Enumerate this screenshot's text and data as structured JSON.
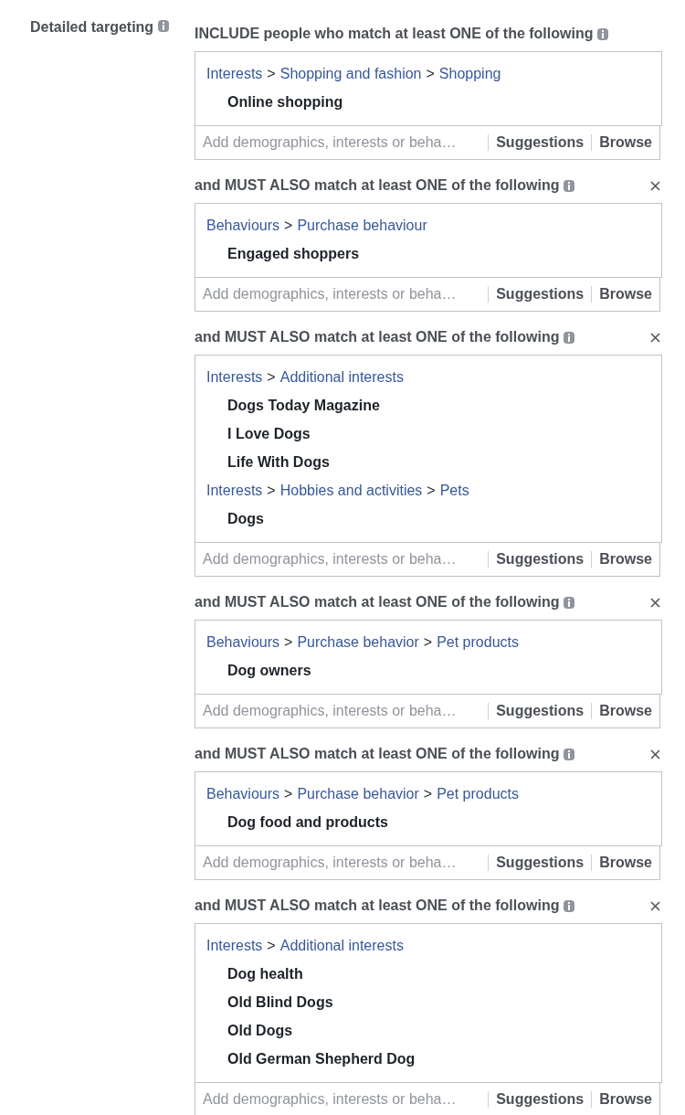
{
  "label": "Detailed targeting",
  "groups": [
    {
      "heading": "INCLUDE people who match at least ONE of the following",
      "removable": false,
      "paths": [
        {
          "crumbs": [
            "Interests",
            ">",
            "Shopping and fashion",
            ">",
            "Shopping"
          ],
          "items": [
            "Online shopping"
          ]
        }
      ],
      "placeholder": "Add demographics, interests or beha…",
      "suggestions": "Suggestions",
      "browse": "Browse"
    },
    {
      "heading": "and MUST ALSO match at least ONE of the following",
      "removable": true,
      "paths": [
        {
          "crumbs": [
            "Behaviours",
            ">",
            "Purchase behaviour"
          ],
          "items": [
            "Engaged shoppers"
          ]
        }
      ],
      "placeholder": "Add demographics, interests or beha…",
      "suggestions": "Suggestions",
      "browse": "Browse"
    },
    {
      "heading": "and MUST ALSO match at least ONE of the following",
      "removable": true,
      "paths": [
        {
          "crumbs": [
            "Interests",
            ">",
            "Additional interests"
          ],
          "items": [
            "Dogs Today Magazine",
            "I Love Dogs",
            "Life With Dogs"
          ]
        },
        {
          "crumbs": [
            "Interests",
            ">",
            "Hobbies and activities",
            ">",
            "Pets"
          ],
          "items": [
            "Dogs"
          ]
        }
      ],
      "placeholder": "Add demographics, interests or beha…",
      "suggestions": "Suggestions",
      "browse": "Browse"
    },
    {
      "heading": "and MUST ALSO match at least ONE of the following",
      "removable": true,
      "paths": [
        {
          "crumbs": [
            "Behaviours",
            ">",
            "Purchase behavior",
            ">",
            "Pet products"
          ],
          "items": [
            "Dog owners"
          ]
        }
      ],
      "placeholder": "Add demographics, interests or beha…",
      "suggestions": "Suggestions",
      "browse": "Browse"
    },
    {
      "heading": "and MUST ALSO match at least ONE of the following",
      "removable": true,
      "paths": [
        {
          "crumbs": [
            "Behaviours",
            ">",
            "Purchase behavior",
            ">",
            "Pet products"
          ],
          "items": [
            "Dog food and products"
          ]
        }
      ],
      "placeholder": "Add demographics, interests or beha…",
      "suggestions": "Suggestions",
      "browse": "Browse"
    },
    {
      "heading": "and MUST ALSO match at least ONE of the following",
      "removable": true,
      "paths": [
        {
          "crumbs": [
            "Interests",
            ">",
            "Additional interests"
          ],
          "items": [
            "Dog health",
            "Old Blind Dogs",
            "Old Dogs",
            "Old German Shepherd Dog"
          ]
        }
      ],
      "placeholder": "Add demographics, interests or beha…",
      "suggestions": "Suggestions",
      "browse": "Browse"
    }
  ]
}
